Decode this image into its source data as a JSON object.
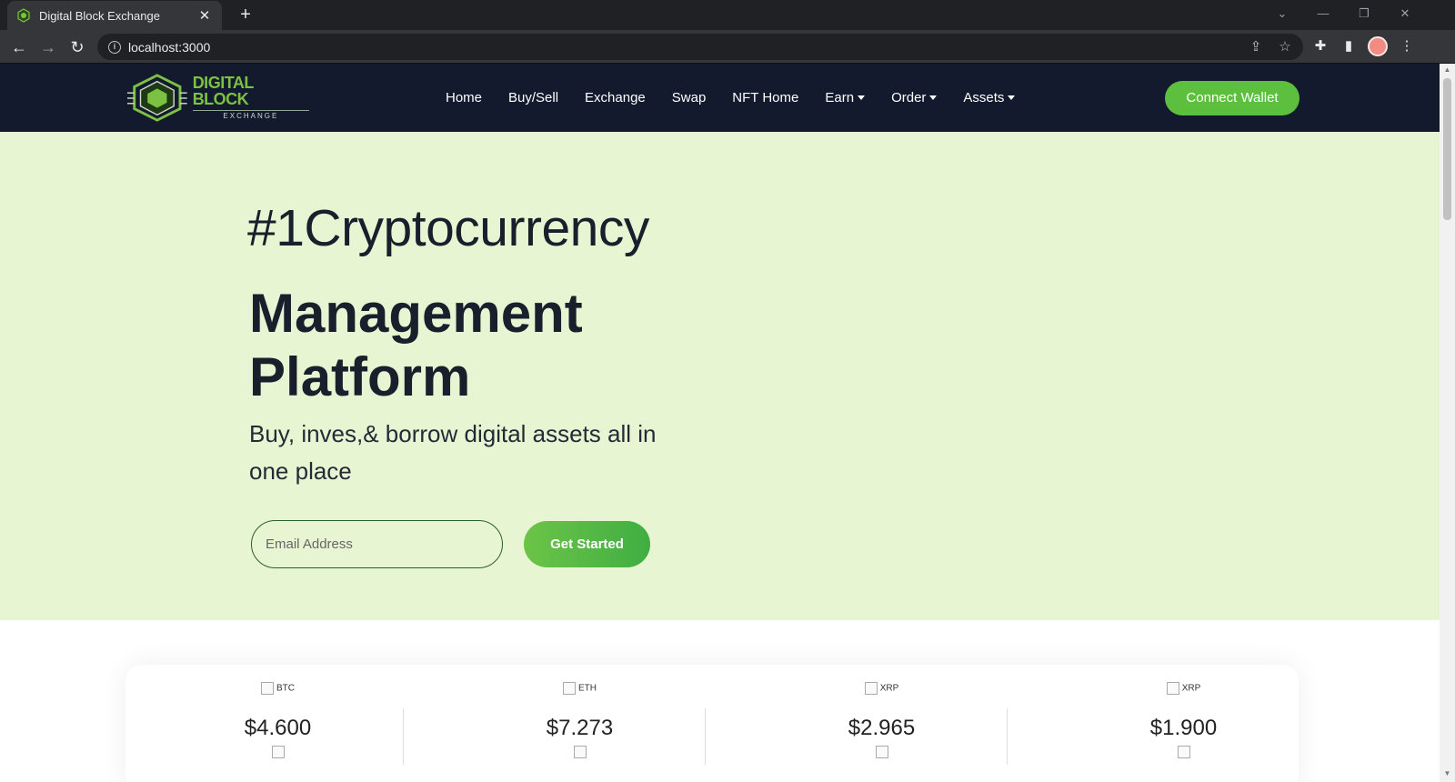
{
  "browser": {
    "tab_title": "Digital Block Exchange",
    "tab_close": "✕",
    "new_tab": "+",
    "url": "localhost:3000"
  },
  "site": {
    "logo": {
      "line1": "DIGITAL BLOCK",
      "line2": "EXCHANGE"
    },
    "menu": [
      {
        "label": "Home",
        "dropdown": false
      },
      {
        "label": "Buy/Sell",
        "dropdown": false
      },
      {
        "label": "Exchange",
        "dropdown": false
      },
      {
        "label": "Swap",
        "dropdown": false
      },
      {
        "label": "NFT Home",
        "dropdown": false
      },
      {
        "label": "Earn",
        "dropdown": true
      },
      {
        "label": "Order",
        "dropdown": true
      },
      {
        "label": "Assets",
        "dropdown": true
      }
    ],
    "connect_label": "Connect Wallet"
  },
  "hero": {
    "line1": "#1Cryptocurrency",
    "line2": "Management Platform",
    "subtitle": "Buy, inves,& borrow digital assets all in one place",
    "email_placeholder": "Email Address",
    "cta_label": "Get Started"
  },
  "tickers": [
    {
      "symbol": "BTC",
      "price": "$4.600"
    },
    {
      "symbol": "ETH",
      "price": "$7.273"
    },
    {
      "symbol": "XRP",
      "price": "$2.965"
    },
    {
      "symbol": "XRP",
      "price": "$1.900"
    }
  ],
  "colors": {
    "nav_bg": "#131a2e",
    "accent_green": "#5cbf3d",
    "hero_bg": "#e8f5d2"
  }
}
